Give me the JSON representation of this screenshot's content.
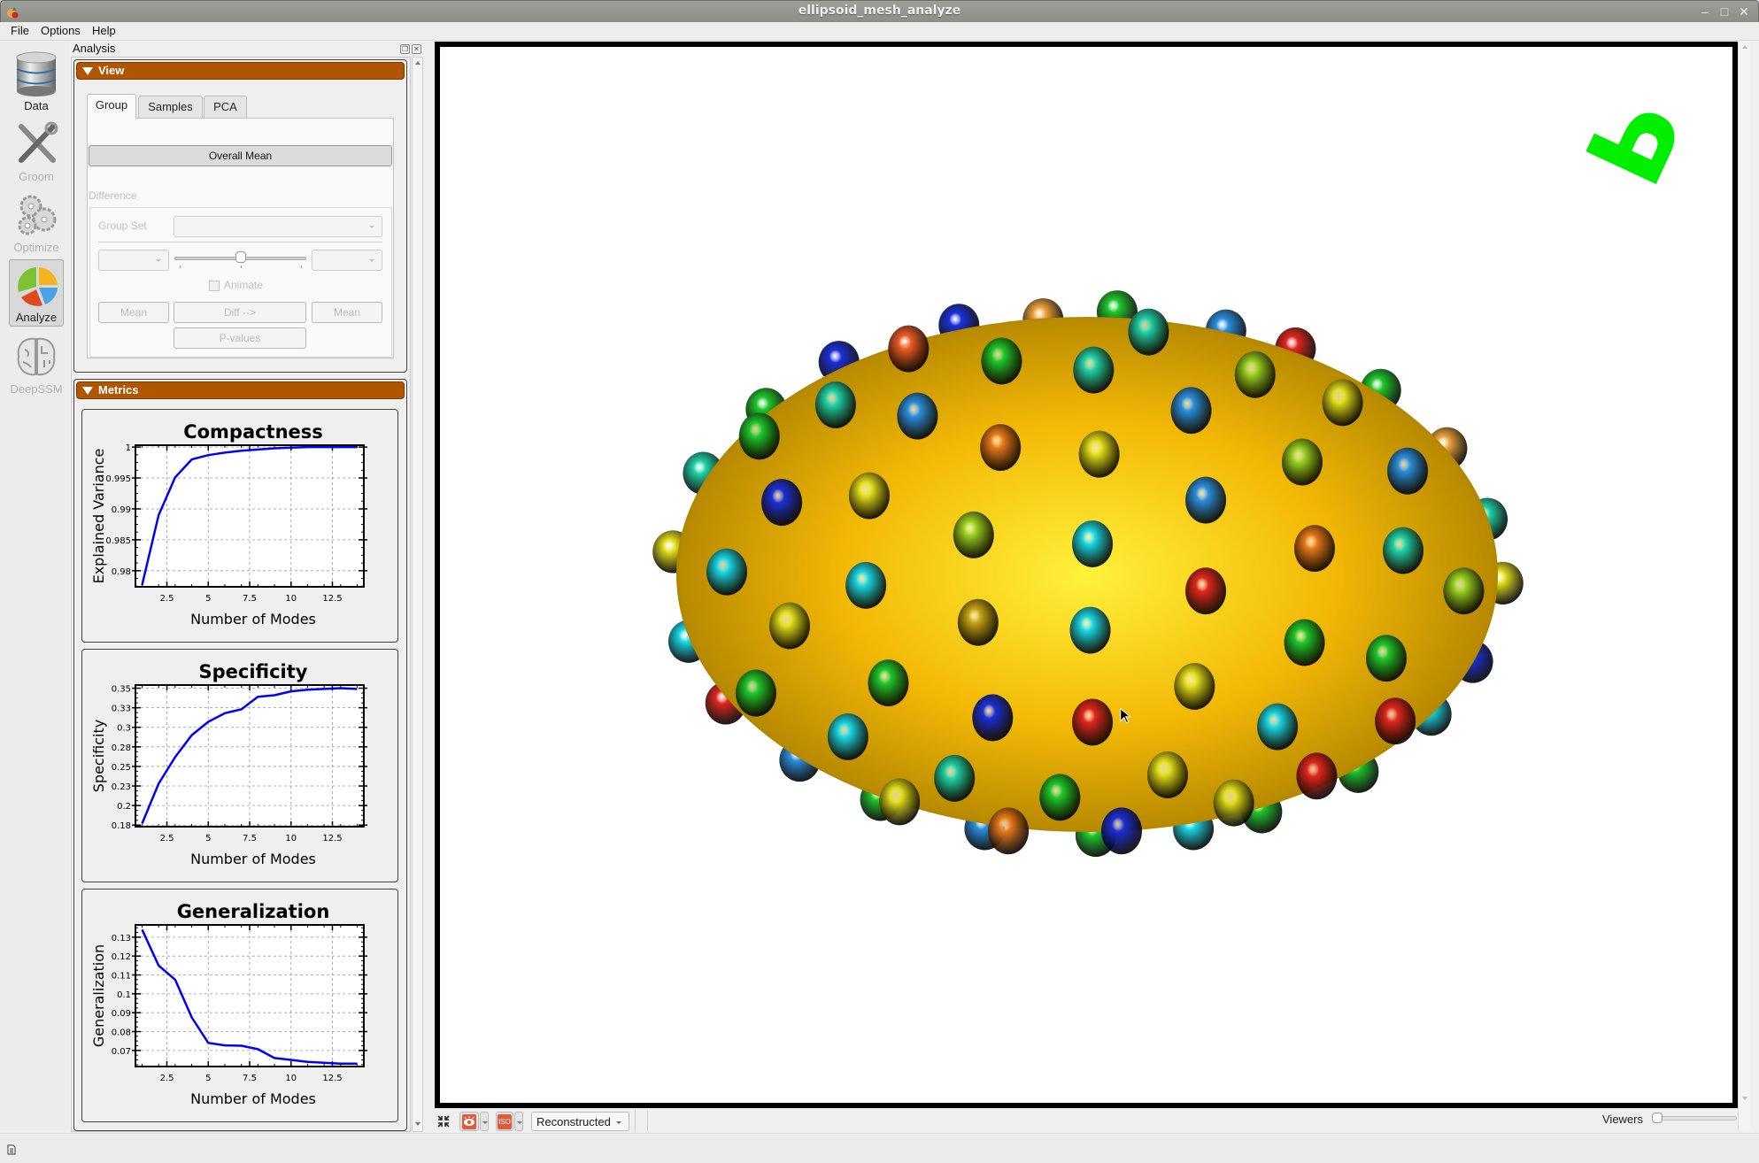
{
  "window": {
    "title": "ellipsoid_mesh_analyze"
  },
  "menu": [
    "File",
    "Options",
    "Help"
  ],
  "modules": [
    {
      "label": "Data",
      "state": "enabled"
    },
    {
      "label": "Groom",
      "state": "disabled"
    },
    {
      "label": "Optimize",
      "state": "disabled"
    },
    {
      "label": "Analyze",
      "state": "active"
    },
    {
      "label": "DeepSSM",
      "state": "disabled"
    }
  ],
  "dock": {
    "title": "Analysis"
  },
  "view_panel": {
    "header": "View",
    "tabs": [
      "Group",
      "Samples",
      "PCA"
    ],
    "active_tab": "Group",
    "overall_mean_label": "Overall Mean",
    "difference_label": "Difference",
    "group_set_label": "Group Set",
    "group_set_value": "",
    "left_group_value": "",
    "right_group_value": "",
    "group_slider_fraction": 0.5,
    "animate_label": "Animate",
    "animate_checked": false,
    "mean_left_label": "Mean",
    "diff_label": "Diff -->",
    "mean_right_label": "Mean",
    "pvalues_label": "P-values"
  },
  "metrics_panel": {
    "header": "Metrics"
  },
  "chart_data": [
    {
      "type": "line",
      "title": "Compactness",
      "xlabel": "Number of Modes",
      "ylabel": "Explained Variance",
      "x": [
        1,
        2,
        3,
        4,
        5,
        6,
        7,
        8,
        9,
        10,
        11,
        12,
        13,
        14
      ],
      "series": [
        {
          "name": "Compactness",
          "color": "#0000ff",
          "values": [
            0.9777,
            0.989,
            0.9951,
            0.998,
            0.9987,
            0.9991,
            0.9994,
            0.9996,
            0.9998,
            0.9999,
            1.0,
            1.0,
            1.0,
            1.0
          ]
        }
      ],
      "xlim": [
        0.6,
        14.4
      ],
      "ylim": [
        0.9774,
        1.0003
      ],
      "xticks": [
        2.5,
        5,
        7.5,
        10,
        12.5
      ],
      "xtick_labels": [
        "2.5",
        "5",
        "7.5",
        "10",
        "12.5"
      ],
      "yticks": [
        0.98,
        0.985,
        0.99,
        0.995,
        1.0
      ],
      "ytick_labels": [
        "0.98",
        "0.985",
        "0.99",
        "0.995",
        "1"
      ],
      "grid": true
    },
    {
      "type": "line",
      "title": "Specificity",
      "xlabel": "Number of Modes",
      "ylabel": "Specificity",
      "x": [
        1,
        2,
        3,
        4,
        5,
        6,
        7,
        8,
        9,
        10,
        11,
        12,
        13,
        14
      ],
      "series": [
        {
          "name": "Specificity",
          "color": "#0000ff",
          "values": [
            0.177,
            0.228,
            0.262,
            0.29,
            0.307,
            0.318,
            0.323,
            0.339,
            0.341,
            0.346,
            0.348,
            0.349,
            0.35,
            0.349
          ]
        }
      ],
      "xlim": [
        0.6,
        14.4
      ],
      "ylim": [
        0.173,
        0.354
      ],
      "xticks": [
        2.5,
        5,
        7.5,
        10,
        12.5
      ],
      "xtick_labels": [
        "2.5",
        "5",
        "7.5",
        "10",
        "12.5"
      ],
      "yticks": [
        0.175,
        0.2,
        0.225,
        0.25,
        0.275,
        0.3,
        0.325,
        0.35
      ],
      "ytick_labels": [
        "0.18",
        "0.2",
        "0.23",
        "0.25",
        "0.28",
        "0.3",
        "0.33",
        "0.35"
      ],
      "grid": true
    },
    {
      "type": "line",
      "title": "Generalization",
      "xlabel": "Number of Modes",
      "ylabel": "Generalization",
      "x": [
        1,
        2,
        3,
        4,
        5,
        6,
        7,
        8,
        9,
        10,
        11,
        12,
        13,
        14
      ],
      "series": [
        {
          "name": "Generalization",
          "color": "#0000ff",
          "values": [
            0.134,
            0.115,
            0.1075,
            0.0875,
            0.074,
            0.0727,
            0.0725,
            0.0707,
            0.066,
            0.065,
            0.064,
            0.0635,
            0.063,
            0.063
          ]
        }
      ],
      "xlim": [
        0.6,
        14.4
      ],
      "ylim": [
        0.0615,
        0.1365
      ],
      "xticks": [
        2.5,
        5,
        7.5,
        10,
        12.5
      ],
      "xtick_labels": [
        "2.5",
        "5",
        "7.5",
        "10",
        "12.5"
      ],
      "yticks": [
        0.07,
        0.08,
        0.09,
        0.1,
        0.11,
        0.12,
        0.13
      ],
      "ytick_labels": [
        "0.07",
        "0.08",
        "0.09",
        "0.1",
        "0.11",
        "0.12",
        "0.13"
      ],
      "grid": true
    }
  ],
  "viewer": {
    "orientation_marker": "P",
    "surface_color": "#f2b705",
    "particle_count": 70
  },
  "bottom_toolbar": {
    "display_mode": "Reconstructed",
    "iso_label": "ISO",
    "viewers_label": "Viewers",
    "viewers_slider_fraction": 0.0
  },
  "colors": {
    "accent_header": "#b05500",
    "plot_line": "#0000ff"
  }
}
